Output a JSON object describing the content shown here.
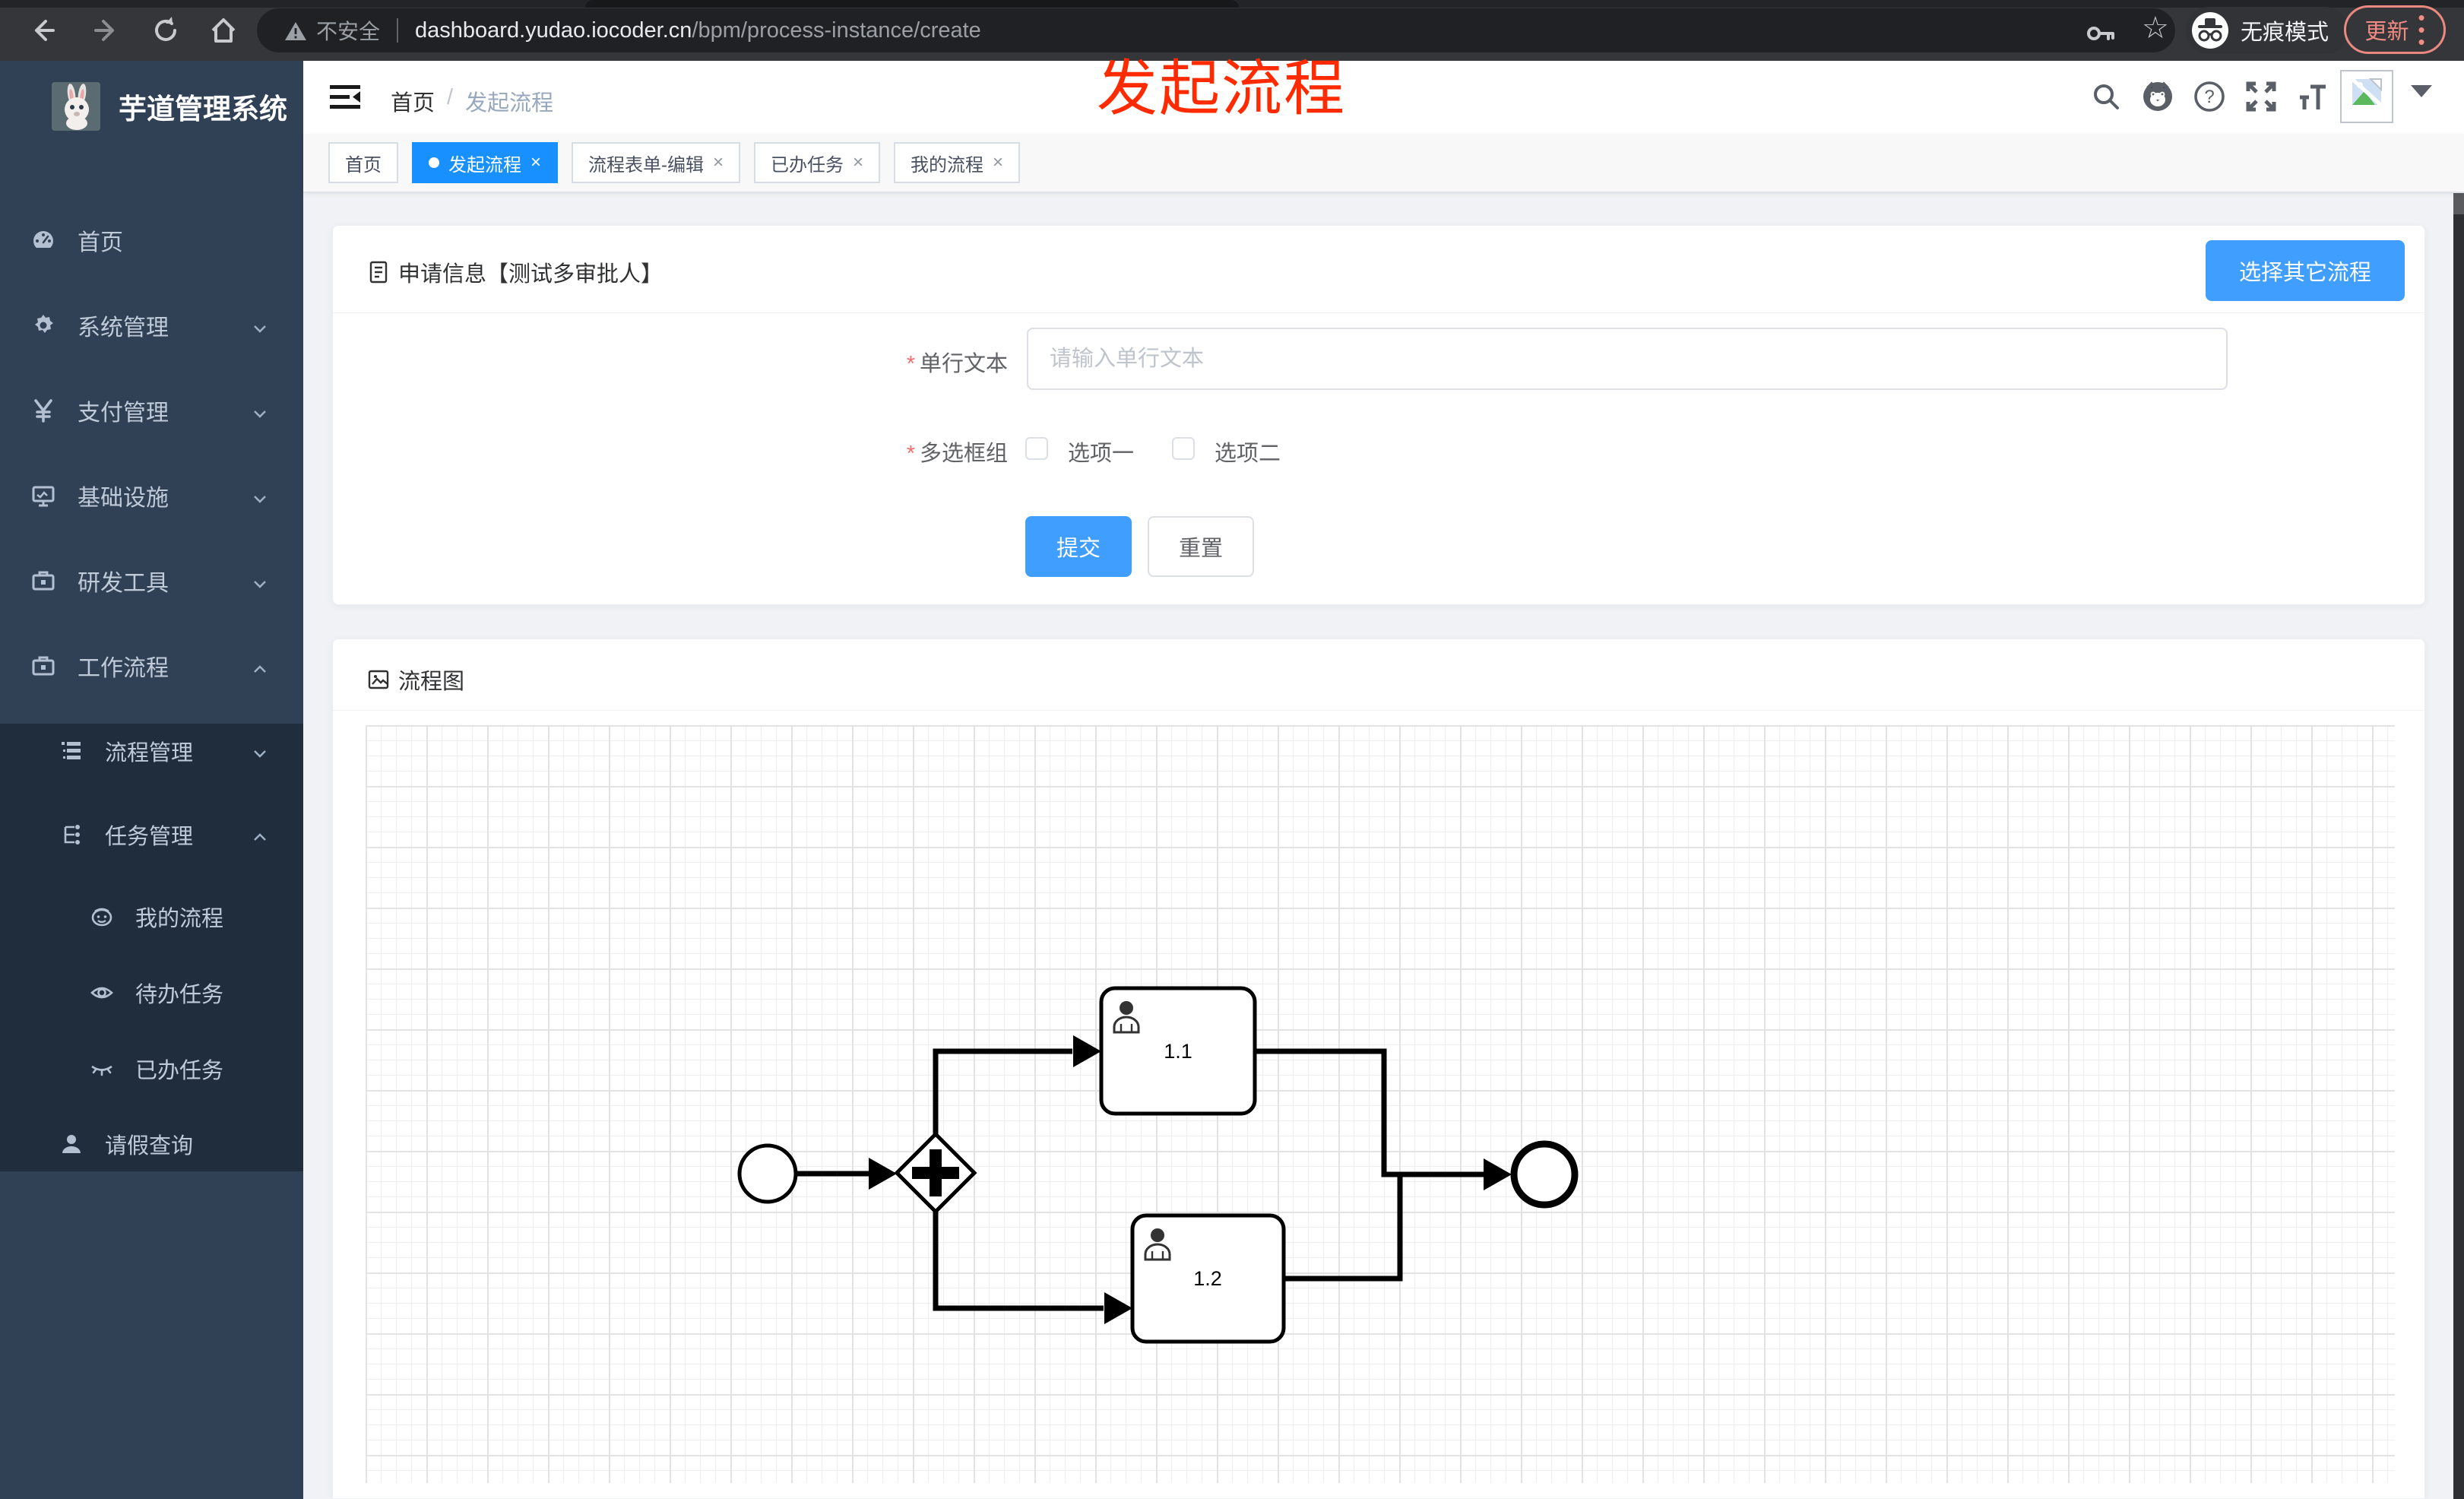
{
  "browser": {
    "security_label": "不安全",
    "url_host": "dashboard.yudao.iocoder.cn",
    "url_path": "/bpm/process-instance/create",
    "incognito_label": "无痕模式",
    "update_label": "更新",
    "menu_dots": "⋮"
  },
  "annotation": {
    "text": "发起流程",
    "color": "#fe2b00"
  },
  "sidebar": {
    "title": "芋道管理系统",
    "items": [
      {
        "label": "首页",
        "icon": "dashboard-icon",
        "chevron": "none"
      },
      {
        "label": "系统管理",
        "icon": "gear-icon",
        "chevron": "down"
      },
      {
        "label": "支付管理",
        "icon": "yen-icon",
        "chevron": "down"
      },
      {
        "label": "基础设施",
        "icon": "monitor-icon",
        "chevron": "down"
      },
      {
        "label": "研发工具",
        "icon": "toolbox-icon",
        "chevron": "down"
      },
      {
        "label": "工作流程",
        "icon": "briefcase-icon",
        "chevron": "up"
      }
    ],
    "submenu": [
      {
        "label": "流程管理",
        "icon": "tree-list-icon",
        "chevron": "down"
      },
      {
        "label": "任务管理",
        "icon": "org-tree-icon",
        "chevron": "up"
      },
      {
        "label": "我的流程",
        "icon": "face-icon"
      },
      {
        "label": "待办任务",
        "icon": "eye-open-icon"
      },
      {
        "label": "已办任务",
        "icon": "eye-closed-icon"
      },
      {
        "label": "请假查询",
        "icon": "user-icon"
      }
    ]
  },
  "header": {
    "breadcrumb_home": "首页",
    "breadcrumb_sep": "/",
    "breadcrumb_current": "发起流程"
  },
  "tabs": {
    "close_glyph": "×",
    "items": [
      {
        "label": "首页",
        "active": false,
        "closable": false
      },
      {
        "label": "发起流程",
        "active": true,
        "closable": true
      },
      {
        "label": "流程表单-编辑",
        "active": false,
        "closable": true
      },
      {
        "label": "已办任务",
        "active": false,
        "closable": true
      },
      {
        "label": "我的流程",
        "active": false,
        "closable": true
      }
    ]
  },
  "form_card": {
    "title": "申请信息【测试多审批人】",
    "select_other_button": "选择其它流程",
    "required_mark": "*",
    "fields": [
      {
        "label": "单行文本",
        "required": true,
        "type": "input",
        "value": "",
        "placeholder": "请输入单行文本"
      },
      {
        "label": "多选框组",
        "required": true,
        "type": "checkbox-group",
        "options": [
          {
            "label": "选项一",
            "checked": false
          },
          {
            "label": "选项二",
            "checked": false
          }
        ]
      }
    ],
    "submit_label": "提交",
    "reset_label": "重置"
  },
  "diagram_card": {
    "title": "流程图",
    "type": "bpmn",
    "nodes": {
      "start_event": "start",
      "parallel_gateway": "+",
      "task1": "1.1",
      "task2": "1.2",
      "end_event": "end"
    }
  },
  "colors": {
    "accent_button": "#409eff",
    "active_tab": "#1890ff",
    "sidebar_bg": "#304156",
    "submenu_bg": "#1f2d3d",
    "sidebar_text": "#bfcbd9",
    "annotation_red": "#fe2b00",
    "update_red": "#f28b82",
    "page_bg": "#f0f2f5"
  }
}
